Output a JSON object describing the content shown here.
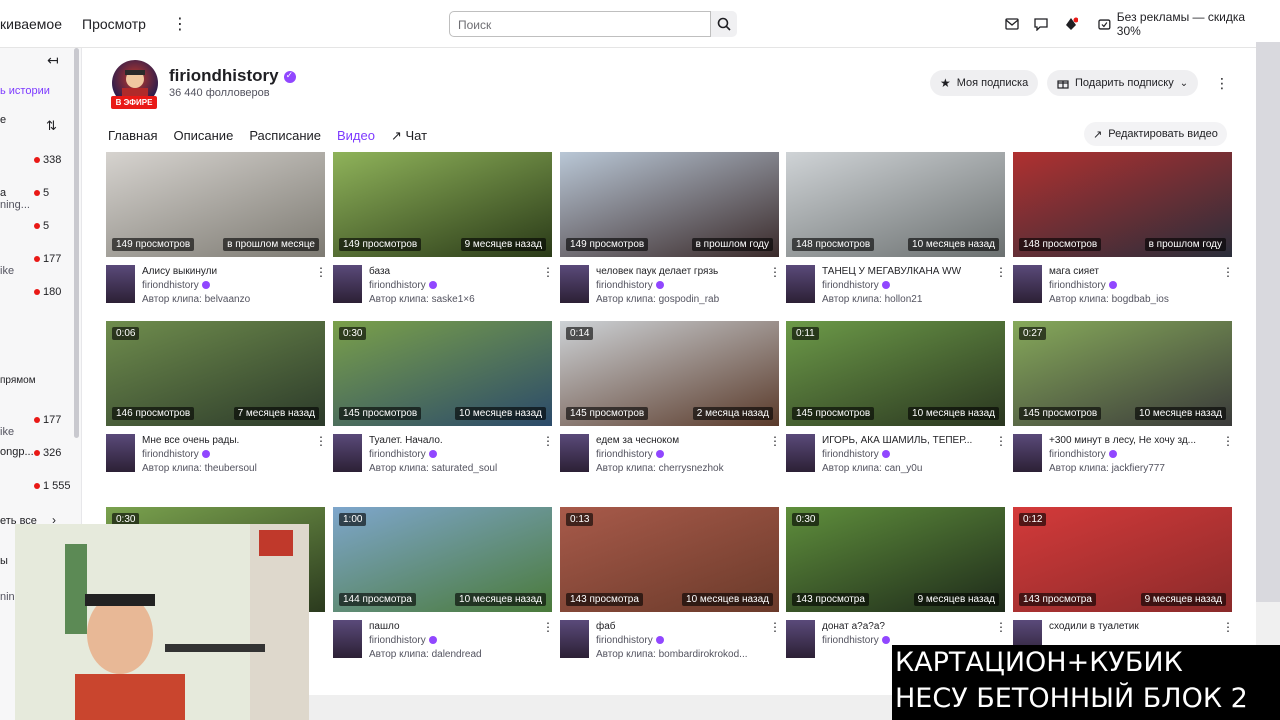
{
  "topbar": {
    "left_link": "киваемое",
    "browse": "Просмотр",
    "search_placeholder": "Поиск",
    "ad_free": "Без рекламы — скидка 30%"
  },
  "sidebar": {
    "items": [
      {
        "text": "ь истории"
      },
      {
        "text": "е"
      },
      {
        "count": "338"
      },
      {
        "text": "а",
        "count": "5"
      },
      {
        "text": "ning..."
      },
      {
        "count": "5"
      },
      {
        "count": "177"
      },
      {
        "text": "ike"
      },
      {
        "count": "180"
      },
      {
        "text": "прямом"
      },
      {
        "count": "177"
      },
      {
        "text": "ike"
      },
      {
        "text": "ongp...",
        "count": "326"
      },
      {
        "count": "1 555"
      },
      {
        "text": "еть все"
      },
      {
        "text": "ы"
      },
      {
        "text": "ning"
      }
    ]
  },
  "channel": {
    "name": "firiondhistory",
    "followers": "36 440 фолловеров",
    "live_badge": "В ЭФИРЕ",
    "my_sub": "Моя подписка",
    "gift_sub": "Подарить подписку"
  },
  "tabs": [
    "Главная",
    "Описание",
    "Расписание",
    "Видео",
    "Чат"
  ],
  "active_tab": "Видео",
  "edit_video": "Редактировать видео",
  "clips": [
    {
      "dur": "",
      "views": "149 просмотров",
      "date": "в прошлом месяце",
      "title": "Алису выкинули",
      "channel": "firiondhistory",
      "author": "Автор клипа: belvaanzo",
      "colors": [
        "#d6d3cf",
        "#7d7a72"
      ]
    },
    {
      "dur": "",
      "views": "149 просмотров",
      "date": "9 месяцев назад",
      "title": "база",
      "channel": "firiondhistory",
      "author": "Автор клипа: saske1×6",
      "colors": [
        "#8fb35a",
        "#2a3a18"
      ]
    },
    {
      "dur": "",
      "views": "149 просмотров",
      "date": "в прошлом году",
      "title": "человек паук делает грязь",
      "channel": "firiondhistory",
      "author": "Автор клипа: gospodin_rab",
      "colors": [
        "#b9c7d6",
        "#3a2a2a"
      ]
    },
    {
      "dur": "",
      "views": "148 просмотров",
      "date": "10 месяцев назад",
      "title": "ТАНЕЦ У МЕГАВУЛКАНА WW",
      "channel": "firiondhistory",
      "author": "Автор клипа: hollon21",
      "colors": [
        "#cfd3d6",
        "#6b7070"
      ]
    },
    {
      "dur": "",
      "views": "148 просмотров",
      "date": "в прошлом году",
      "title": "мага сияет",
      "channel": "firiondhistory",
      "author": "Автор клипа: bogdbab_ios",
      "colors": [
        "#b03030",
        "#2a2e3a"
      ]
    },
    {
      "dur": "0:06",
      "views": "146 просмотров",
      "date": "7 месяцев назад",
      "title": "Мне все очень рады.",
      "channel": "firiondhistory",
      "author": "Автор клипа: theubersoul",
      "colors": [
        "#6f8d4d",
        "#2c3a2a"
      ]
    },
    {
      "dur": "0:30",
      "views": "145 просмотров",
      "date": "10 месяцев назад",
      "title": "Туалет. Начало.",
      "channel": "firiondhistory",
      "author": "Автор клипа: saturated_soul",
      "colors": [
        "#7aa04a",
        "#2b4a6a"
      ]
    },
    {
      "dur": "0:14",
      "views": "145 просмотров",
      "date": "2 месяца назад",
      "title": "едем за чесноком",
      "channel": "firiondhistory",
      "author": "Автор клипа: cherrysnezhok",
      "colors": [
        "#cdd2d6",
        "#5a3a2a"
      ]
    },
    {
      "dur": "0:11",
      "views": "145 просмотров",
      "date": "10 месяцев назад",
      "title": "ИГОРЬ, АКА ШАМИЛЬ, ТЕПЕР...",
      "channel": "firiondhistory",
      "author": "Автор клипа: can_y0u",
      "colors": [
        "#6c9a48",
        "#2a3620"
      ]
    },
    {
      "dur": "0:27",
      "views": "145 просмотров",
      "date": "10 месяцев назад",
      "title": "+300 минут в лесу, Не хочу зд...",
      "channel": "firiondhistory",
      "author": "Автор клипа: jackfiery777",
      "colors": [
        "#86a95a",
        "#3a3a3a"
      ]
    },
    {
      "dur": "0:30",
      "views": "",
      "date": "",
      "title": "",
      "channel": "",
      "author": "",
      "colors": [
        "#7aa24e",
        "#2b3a1e"
      ]
    },
    {
      "dur": "1:00",
      "views": "144 просмотра",
      "date": "10 месяцев назад",
      "title": "пашло",
      "channel": "firiondhistory",
      "author": "Автор клипа: dalendread",
      "colors": [
        "#7ea6cc",
        "#4a7a3a"
      ]
    },
    {
      "dur": "0:13",
      "views": "143 просмотра",
      "date": "10 месяцев назад",
      "title": "фаб",
      "channel": "firiondhistory",
      "author": "Автор клипа: bombardirokrokod...",
      "colors": [
        "#a85a4a",
        "#6a3a2a"
      ]
    },
    {
      "dur": "0:30",
      "views": "143 просмотра",
      "date": "9 месяцев назад",
      "title": "донат а?а?а?",
      "channel": "firiondhistory",
      "author": "",
      "colors": [
        "#5f8f3c",
        "#1e2a1a"
      ]
    },
    {
      "dur": "0:12",
      "views": "143 просмотра",
      "date": "9 месяцев назад",
      "title": "сходили в туалетик",
      "channel": "",
      "author": "",
      "colors": [
        "#d43a3a",
        "#8a2a2a"
      ]
    }
  ],
  "overlay": {
    "line1": "КАРТАЦИОН+КУБИК",
    "line2": "НЕСУ БЕТОННЫЙ БЛОК 2"
  }
}
